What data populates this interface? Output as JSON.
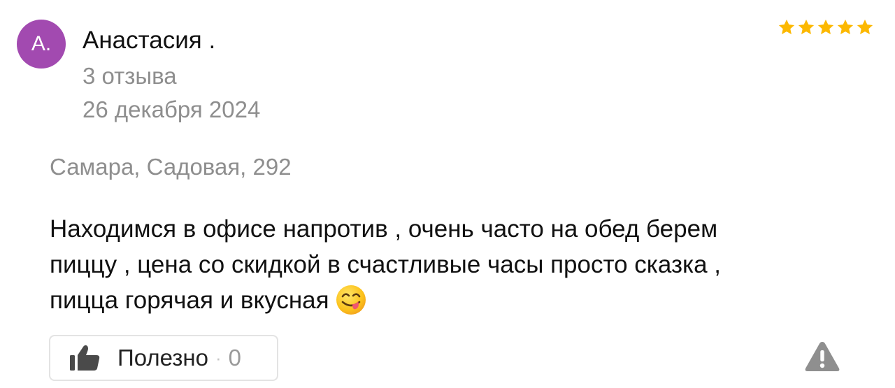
{
  "review": {
    "author": {
      "initials": "А.",
      "name": "Анастасия .",
      "avatar_color": "#a24ab0",
      "review_count": "3 отзыва"
    },
    "date": "26 декабря 2024",
    "rating": 5,
    "star_color": "#fcb800",
    "branch_address": "Самара, Садовая, 292",
    "text_lines": [
      "Находимся в офисе напротив , очень часто на обед берем",
      "пиццу , цена со скидкой в счастливые часы просто сказка ,",
      "пицца горячая и вкусная"
    ],
    "emoji": "face-savoring-food"
  },
  "actions": {
    "helpful_label": "Полезно",
    "helpful_separator": "·",
    "helpful_count": "0",
    "helpful_icon": "thumbs-up-icon",
    "report_icon": "warning-icon"
  }
}
